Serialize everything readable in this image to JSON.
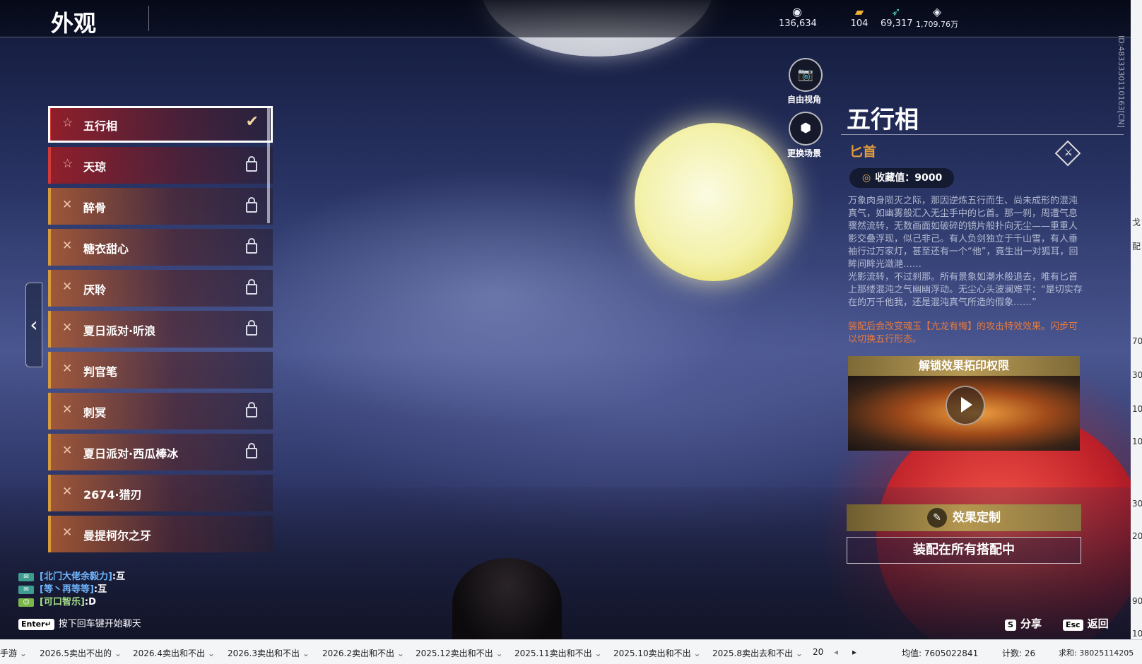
{
  "header": {
    "title": "外观"
  },
  "currencies": [
    {
      "icon": "mask-icon",
      "value": "136,634"
    },
    {
      "icon": "ticket-icon",
      "value": "104"
    },
    {
      "icon": "feather-icon",
      "value": "69,317"
    },
    {
      "icon": "diamond-icon",
      "value": "1,709.76万"
    }
  ],
  "skins": [
    {
      "label": "五行相",
      "state": "selected"
    },
    {
      "label": "天琼",
      "state": "locked"
    },
    {
      "label": "醉骨",
      "state": "locked"
    },
    {
      "label": "糖衣甜心",
      "state": "locked"
    },
    {
      "label": "厌聆",
      "state": "locked"
    },
    {
      "label": "夏日派对·听浪",
      "state": "locked"
    },
    {
      "label": "判官笔",
      "state": "owned"
    },
    {
      "label": "刺冥",
      "state": "locked"
    },
    {
      "label": "夏日派对·西瓜棒冰",
      "state": "locked"
    },
    {
      "label": "2674·猎刃",
      "state": "owned"
    },
    {
      "label": "曼提柯尔之牙",
      "state": "owned"
    }
  ],
  "camera": {
    "free_view": "自由视角",
    "change_scene": "更换场景"
  },
  "detail": {
    "title": "五行相",
    "subtitle": "匕首",
    "collect_value": "收藏值：9000",
    "desc1": "万象肉身陨灭之际，那因逆炼五行而生、尚未成形的混沌真气，如幽雾般汇入无尘手中的匕首。那一刹，周遭气息骤然流转，无数画面如破碎的镜片般扑向无尘——重重人影交叠浮现，似己非己。有人负剑独立于千山雪，有人垂袖行过万家灯，甚至还有一个“他”，竟生出一对狐耳，回眸间眸光潋滟……",
    "desc2": "光影流转，不过刹那。所有景象如潮水般退去，唯有匕首上那缕混沌之气幽幽浮动。无尘心头波澜难平：“是切实存在的万千他我，还是混沌真气所造的假象……”",
    "effect_note": "装配后会改变魂玉【亢龙有悔】的攻击特效效果。闪步可以切换五行形态。",
    "video_title": "解锁效果拓印权限",
    "customize_btn": "效果定制",
    "equip_btn": "装配在所有搭配中"
  },
  "player_id": "ID:4833330110163[CN]",
  "chat": [
    {
      "name": "[北门大佬余毅力]",
      "msg": ":互"
    },
    {
      "name": "[等丶再等等]",
      "msg": ":互"
    },
    {
      "name": "[可口智乐]",
      "msg": ":D"
    }
  ],
  "chat_hint": {
    "key": "Enter↵",
    "text": "按下回车键开始聊天"
  },
  "shortcuts": {
    "share_key": "S",
    "share": "分享",
    "back_key": "Esc",
    "back": "返回"
  },
  "right_edge": [
    "戈",
    "配",
    "70",
    "30",
    "10",
    "10",
    "30",
    "20",
    "90",
    "10"
  ],
  "taskbar": {
    "tabs": [
      "手游",
      "2026.5卖出不出的",
      "2026.4卖出和不出",
      "2026.3卖出和不出",
      "2026.2卖出和不出",
      "2025.12卖出和不出",
      "2025.11卖出和不出",
      "2025.10卖出和不出",
      "2025.8卖出去和不出",
      "20"
    ],
    "average": "均值: 7605022841",
    "count": "计数: 26",
    "sum": "求和: 38025114205"
  }
}
